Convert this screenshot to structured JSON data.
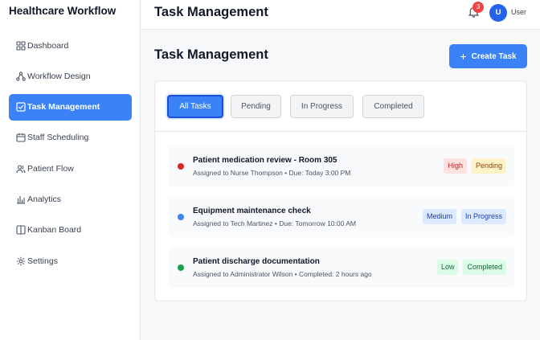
{
  "sidebar": {
    "brand": "Healthcare Workflow",
    "items": [
      {
        "label": "Dashboard",
        "icon": "grid-icon",
        "active": false
      },
      {
        "label": "Workflow Design",
        "icon": "workflow-icon",
        "active": false
      },
      {
        "label": "Task Management",
        "icon": "check-square-icon",
        "active": true
      },
      {
        "label": "Staff Scheduling",
        "icon": "calendar-icon",
        "active": false
      },
      {
        "label": "Patient Flow",
        "icon": "users-icon",
        "active": false
      },
      {
        "label": "Analytics",
        "icon": "bar-chart-icon",
        "active": false
      },
      {
        "label": "Kanban Board",
        "icon": "columns-icon",
        "active": false
      },
      {
        "label": "Settings",
        "icon": "gear-icon",
        "active": false
      }
    ]
  },
  "header": {
    "title": "Task Management",
    "notification_count": "3",
    "avatar_initial": "U",
    "user_name": "User"
  },
  "main": {
    "title": "Task Management",
    "create_label": "Create Task",
    "filters": [
      "All Tasks",
      "Pending",
      "In Progress",
      "Completed"
    ],
    "active_filter": "All Tasks",
    "tasks": [
      {
        "title": "Patient medication review - Room 305",
        "meta": "Assigned to Nurse Thompson • Due: Today 3:00 PM",
        "priority": "High",
        "status": "Pending",
        "dot_color": "#dc2626"
      },
      {
        "title": "Equipment maintenance check",
        "meta": "Assigned to Tech Martinez • Due: Tomorrow 10:00 AM",
        "priority": "Medium",
        "status": "In Progress",
        "dot_color": "#3b82f6"
      },
      {
        "title": "Patient discharge documentation",
        "meta": "Assigned to Administrator Wilson • Completed: 2 hours ago",
        "priority": "Low",
        "status": "Completed",
        "dot_color": "#16a34a"
      }
    ]
  },
  "colors": {
    "accent": "#3b82f6",
    "high_bg": "#fde2e2",
    "high_fg": "#b91c1c",
    "pending_bg": "#fef3c7",
    "pending_fg": "#92400e",
    "medium_bg": "#dbeafe",
    "medium_fg": "#1e40af",
    "progress_bg": "#dbeafe",
    "progress_fg": "#1e40af",
    "low_bg": "#dcfce7",
    "low_fg": "#166534",
    "completed_bg": "#dcfce7",
    "completed_fg": "#166534"
  }
}
